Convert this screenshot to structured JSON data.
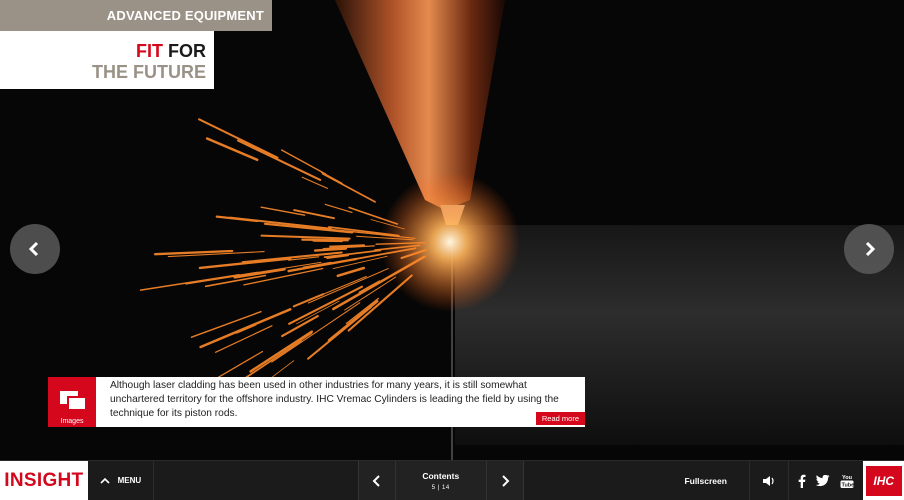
{
  "header": {
    "section": "ADVANCED EQUIPMENT",
    "title_red": "FIT",
    "title_dark": "FOR",
    "title_line2": "THE FUTURE"
  },
  "caption": {
    "thumb_label": "Images",
    "text": "Although laser cladding has been used in other industries for many years, it is still somewhat unchartered territory for the offshore industry. IHC Vremac Cylinders is leading the field by using the technique for its piston rods.",
    "read_more": "Read more"
  },
  "bottombar": {
    "brand": "INSIGHT",
    "menu": "MENU",
    "contents": "Contents",
    "page_current": "5",
    "page_total": "14",
    "fullscreen": "Fullscreen",
    "logo": "IHC"
  },
  "icons": [
    "chevron-left-icon",
    "chevron-right-icon",
    "chevron-up-icon",
    "images-icon",
    "speaker-icon",
    "facebook-icon",
    "twitter-icon",
    "youtube-icon"
  ],
  "colors": {
    "accent": "#d4071c",
    "tag": "#9a9287",
    "bar": "#1b1b1b"
  }
}
